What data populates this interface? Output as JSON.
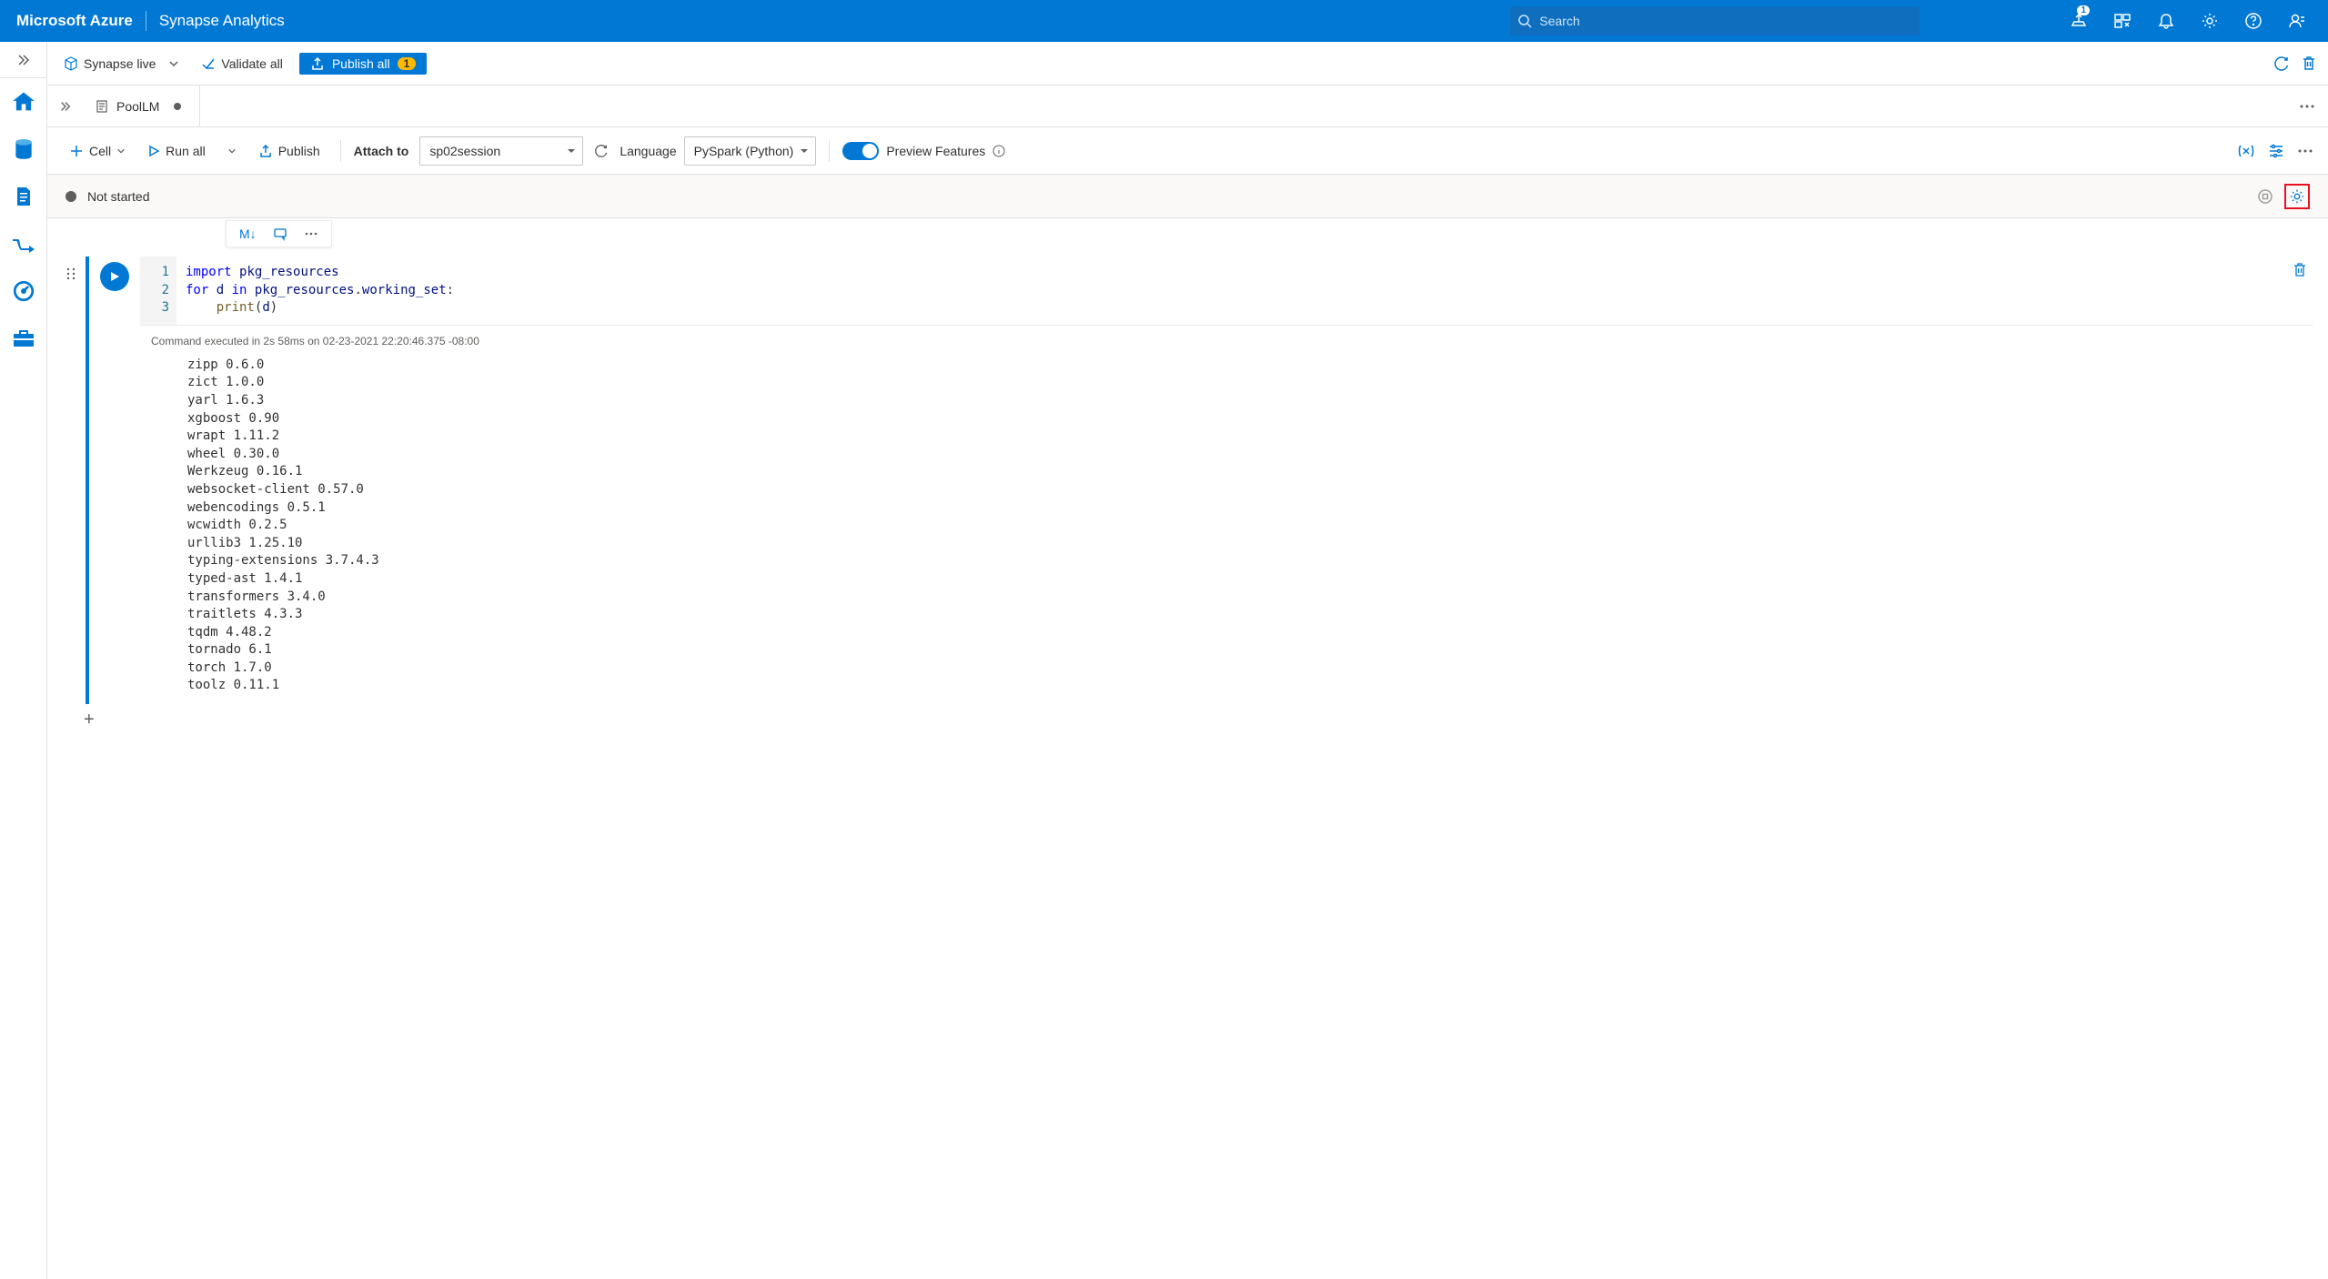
{
  "header": {
    "brand": "Microsoft Azure",
    "service": "Synapse Analytics",
    "search_placeholder": "Search",
    "notification_count": "1"
  },
  "actionbar": {
    "mode": "Synapse live",
    "validate": "Validate all",
    "publish": "Publish all",
    "publish_count": "1"
  },
  "tabs": [
    {
      "name": "PoolLM",
      "dirty": true
    }
  ],
  "notebook_toolbar": {
    "cell": "Cell",
    "run_all": "Run all",
    "publish": "Publish",
    "attach_label": "Attach to",
    "attach_value": "sp02session",
    "language_label": "Language",
    "language_value": "PySpark (Python)",
    "preview_label": "Preview Features"
  },
  "status": {
    "text": "Not started"
  },
  "cell": {
    "floater_markdown": "M↓",
    "line_numbers": "1\n2\n3",
    "code_tokens": [
      {
        "t": "kw",
        "v": "import"
      },
      {
        "t": "",
        "v": " "
      },
      {
        "t": "id",
        "v": "pkg_resources"
      },
      {
        "t": "",
        "v": "\n"
      },
      {
        "t": "kw",
        "v": "for"
      },
      {
        "t": "",
        "v": " "
      },
      {
        "t": "id",
        "v": "d"
      },
      {
        "t": "",
        "v": " "
      },
      {
        "t": "kw",
        "v": "in"
      },
      {
        "t": "",
        "v": " "
      },
      {
        "t": "id",
        "v": "pkg_resources"
      },
      {
        "t": "",
        "v": "."
      },
      {
        "t": "id",
        "v": "working_set"
      },
      {
        "t": "",
        "v": ":\n    "
      },
      {
        "t": "fn",
        "v": "print"
      },
      {
        "t": "",
        "v": "("
      },
      {
        "t": "id",
        "v": "d"
      },
      {
        "t": "",
        "v": ")"
      }
    ],
    "exec_meta": "Command executed in 2s 58ms on 02-23-2021 22:20:46.375 -08:00",
    "output": "zipp 0.6.0\nzict 1.0.0\nyarl 1.6.3\nxgboost 0.90\nwrapt 1.11.2\nwheel 0.30.0\nWerkzeug 0.16.1\nwebsocket-client 0.57.0\nwebencodings 0.5.1\nwcwidth 0.2.5\nurllib3 1.25.10\ntyping-extensions 3.7.4.3\ntyped-ast 1.4.1\ntransformers 3.4.0\ntraitlets 4.3.3\ntqdm 4.48.2\ntornado 6.1\ntorch 1.7.0\ntoolz 0.11.1"
  }
}
